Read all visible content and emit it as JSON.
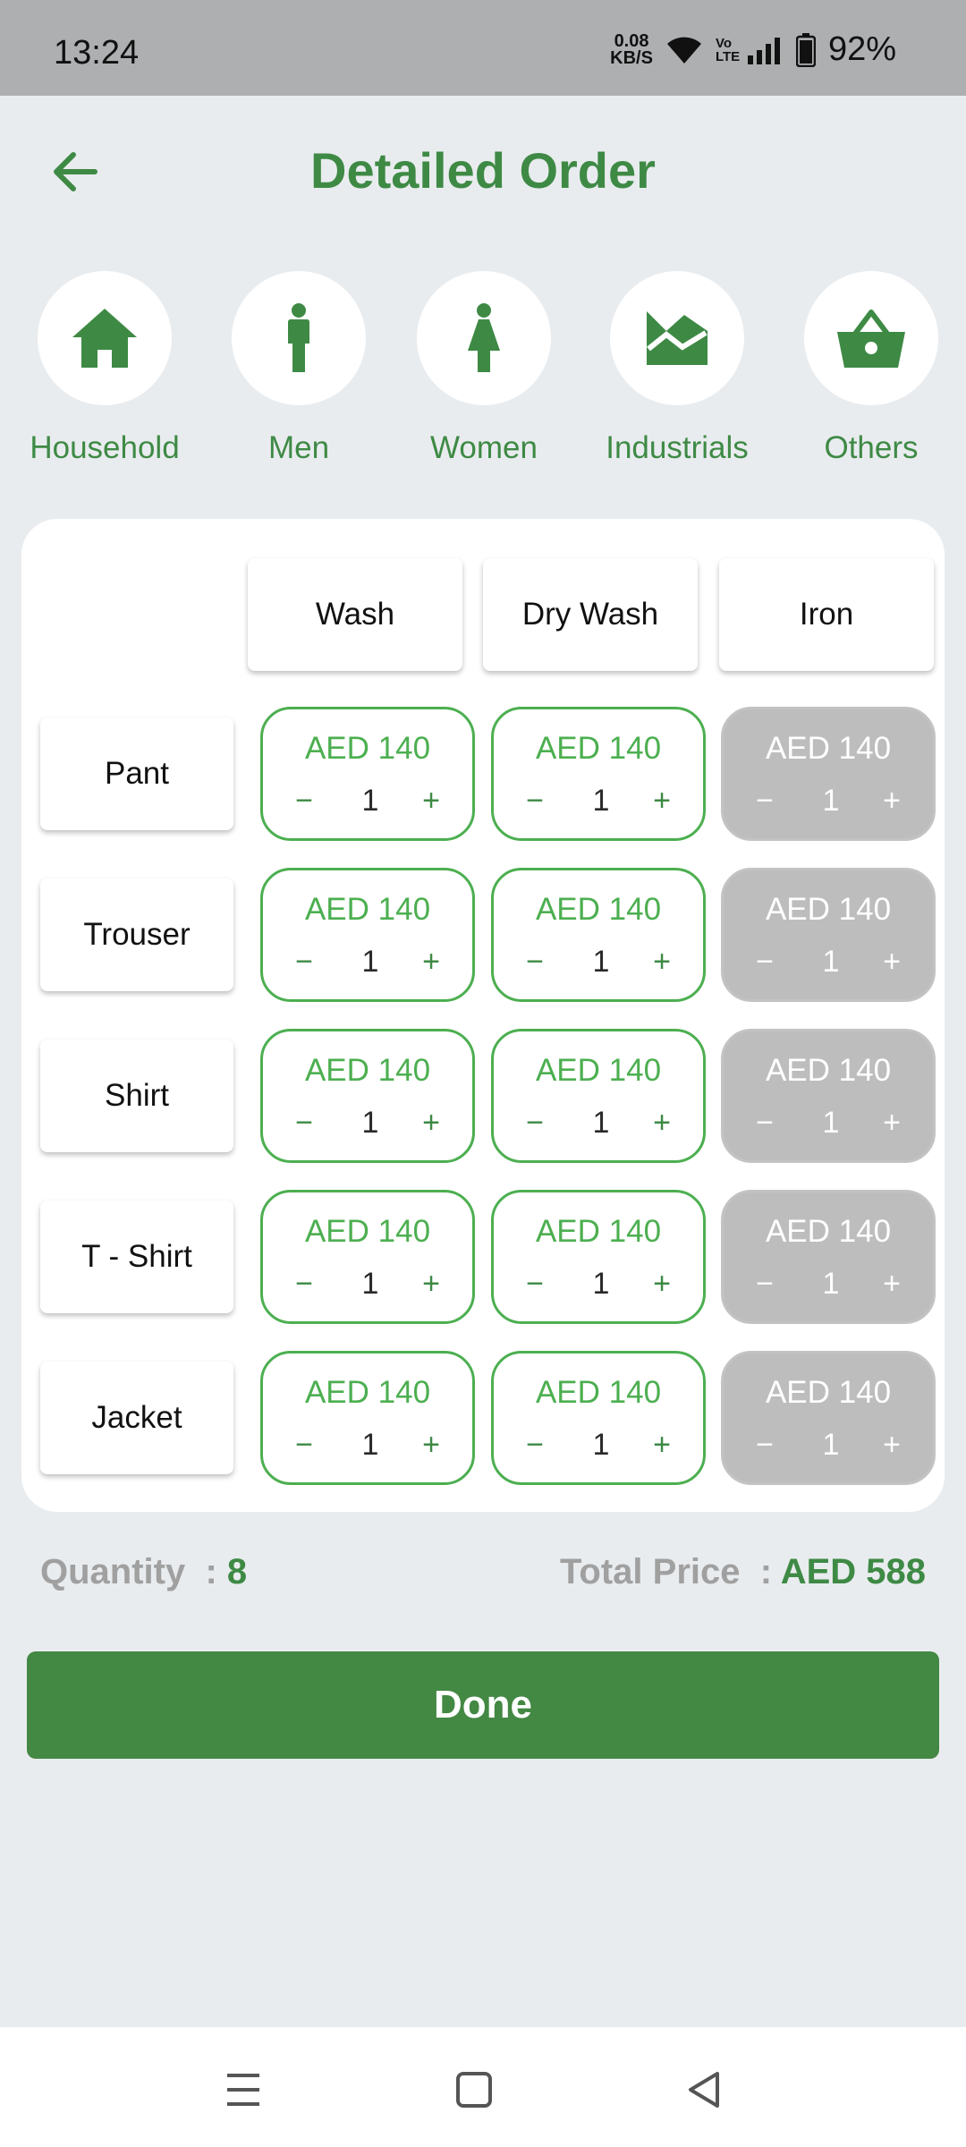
{
  "status_bar": {
    "time": "13:24",
    "speed_value": "0.08",
    "speed_unit": "KB/S",
    "volte": "Vo LTE",
    "battery": "92%"
  },
  "header": {
    "title": "Detailed Order"
  },
  "categories": [
    {
      "label": "Household",
      "icon": "house-icon"
    },
    {
      "label": "Men",
      "icon": "man-icon"
    },
    {
      "label": "Women",
      "icon": "woman-icon"
    },
    {
      "label": "Industrials",
      "icon": "industrial-icon"
    },
    {
      "label": "Others",
      "icon": "basket-icon"
    }
  ],
  "table": {
    "columns": [
      "Wash",
      "Dry Wash",
      "Iron"
    ],
    "rows": [
      {
        "label": "Pant",
        "cells": [
          {
            "price": "AED 140",
            "qty": "1",
            "enabled": true
          },
          {
            "price": "AED 140",
            "qty": "1",
            "enabled": true
          },
          {
            "price": "AED 140",
            "qty": "1",
            "enabled": false
          }
        ]
      },
      {
        "label": "Trouser",
        "cells": [
          {
            "price": "AED 140",
            "qty": "1",
            "enabled": true
          },
          {
            "price": "AED 140",
            "qty": "1",
            "enabled": true
          },
          {
            "price": "AED 140",
            "qty": "1",
            "enabled": false
          }
        ]
      },
      {
        "label": "Shirt",
        "cells": [
          {
            "price": "AED 140",
            "qty": "1",
            "enabled": true
          },
          {
            "price": "AED 140",
            "qty": "1",
            "enabled": true
          },
          {
            "price": "AED 140",
            "qty": "1",
            "enabled": false
          }
        ]
      },
      {
        "label": "T - Shirt",
        "cells": [
          {
            "price": "AED 140",
            "qty": "1",
            "enabled": true
          },
          {
            "price": "AED 140",
            "qty": "1",
            "enabled": true
          },
          {
            "price": "AED 140",
            "qty": "1",
            "enabled": false
          }
        ]
      },
      {
        "label": "Jacket",
        "cells": [
          {
            "price": "AED 140",
            "qty": "1",
            "enabled": true
          },
          {
            "price": "AED 140",
            "qty": "1",
            "enabled": true
          },
          {
            "price": "AED 140",
            "qty": "1",
            "enabled": false
          }
        ]
      }
    ],
    "minus_symbol": "−",
    "plus_symbol": "+"
  },
  "summary": {
    "quantity_label": "Quantity  :",
    "quantity_value": "8",
    "total_label": "Total Price  :",
    "total_value": "AED 588"
  },
  "actions": {
    "done_label": "Done"
  },
  "colors": {
    "brand_green": "#3e8a45",
    "accent_green": "#4caf50",
    "button_green": "#438843",
    "disabled_gray": "#bdbdbd",
    "background": "#e9ecef"
  }
}
